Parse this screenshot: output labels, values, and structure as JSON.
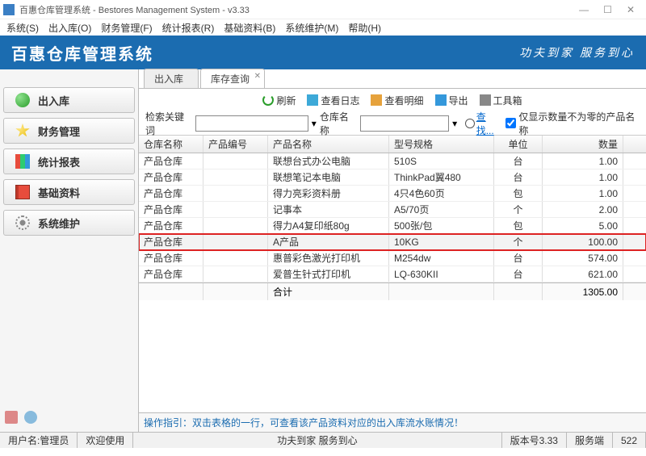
{
  "window": {
    "title": "百惠仓库管理系统 - Bestores Management System - v3.33"
  },
  "menubar": [
    "系统(S)",
    "出入库(O)",
    "财务管理(F)",
    "统计报表(R)",
    "基础资料(B)",
    "系统维护(M)",
    "帮助(H)"
  ],
  "banner": {
    "brand": "百惠仓库管理系统",
    "slogan": "功夫到家 服务到心"
  },
  "sidebar": {
    "items": [
      {
        "label": "出入库",
        "icon": "ic-green"
      },
      {
        "label": "财务管理",
        "icon": "ic-star"
      },
      {
        "label": "统计报表",
        "icon": "ic-chart"
      },
      {
        "label": "基础资料",
        "icon": "ic-book"
      },
      {
        "label": "系统维护",
        "icon": "ic-gear"
      }
    ]
  },
  "tabs": [
    {
      "label": "出入库",
      "active": false,
      "closable": false
    },
    {
      "label": "库存查询",
      "active": true,
      "closable": true
    }
  ],
  "toolbar": [
    {
      "label": "刷新",
      "icon": "ti-refresh"
    },
    {
      "label": "查看日志",
      "icon": "ti-log"
    },
    {
      "label": "查看明细",
      "icon": "ti-detail"
    },
    {
      "label": "导出",
      "icon": "ti-export"
    },
    {
      "label": "工具箱",
      "icon": "ti-tools"
    }
  ],
  "search": {
    "keyword_label": "检索关键词",
    "keyword_value": "",
    "warehouse_label": "仓库名称",
    "warehouse_value": "",
    "find_label": "查找...",
    "checkbox_label": "仅显示数量不为零的产品名称",
    "checkbox_checked": true
  },
  "table": {
    "headers": {
      "warehouse": "仓库名称",
      "code": "产品编号",
      "name": "产品名称",
      "spec": "型号规格",
      "unit": "单位",
      "qty": "数量"
    },
    "rows": [
      {
        "warehouse": "产品仓库",
        "code": "",
        "name": "联想台式办公电脑",
        "spec": "510S",
        "unit": "台",
        "qty": "1.00",
        "hl": false
      },
      {
        "warehouse": "产品仓库",
        "code": "",
        "name": "联想笔记本电脑",
        "spec": "ThinkPad翼480",
        "unit": "台",
        "qty": "1.00",
        "hl": false
      },
      {
        "warehouse": "产品仓库",
        "code": "",
        "name": "得力亮彩资料册",
        "spec": "4只4色60页",
        "unit": "包",
        "qty": "1.00",
        "hl": false
      },
      {
        "warehouse": "产品仓库",
        "code": "",
        "name": "记事本",
        "spec": "A5/70页",
        "unit": "个",
        "qty": "2.00",
        "hl": false
      },
      {
        "warehouse": "产品仓库",
        "code": "",
        "name": "得力A4复印纸80g",
        "spec": "500张/包",
        "unit": "包",
        "qty": "5.00",
        "hl": false
      },
      {
        "warehouse": "产品仓库",
        "code": "",
        "name": "A产品",
        "spec": "10KG",
        "unit": "个",
        "qty": "100.00",
        "hl": true
      },
      {
        "warehouse": "产品仓库",
        "code": "",
        "name": "惠普彩色激光打印机",
        "spec": "M254dw",
        "unit": "台",
        "qty": "574.00",
        "hl": false
      },
      {
        "warehouse": "产品仓库",
        "code": "",
        "name": "爱普生针式打印机",
        "spec": "LQ-630KII",
        "unit": "台",
        "qty": "621.00",
        "hl": false
      }
    ],
    "footer": {
      "label": "合计",
      "total": "1305.00"
    }
  },
  "hint": "操作指引：双击表格的一行，可查看该产品资料对应的出入库流水账情况！",
  "statusbar": {
    "user_label": "用户名:管理员",
    "welcome": "欢迎使用",
    "center": "功夫到家 服务到心",
    "version": "版本号3.33",
    "server": "服务端",
    "count": "522"
  }
}
